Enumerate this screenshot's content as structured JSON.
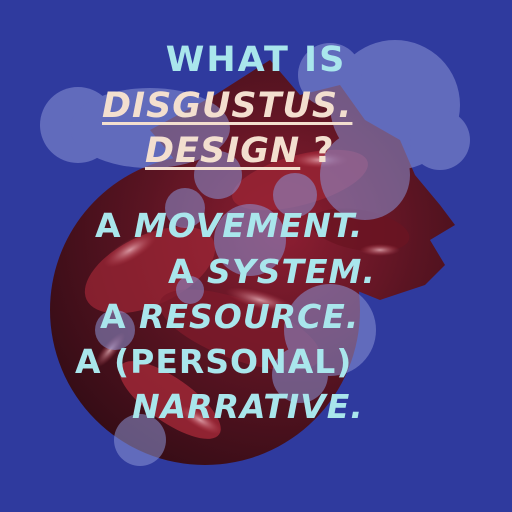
{
  "poster": {
    "question": {
      "line1": "WHAT IS",
      "line2": "DISGUSTUS.",
      "line3_word": "DESIGN",
      "line3_mark": "?"
    },
    "answers": [
      {
        "prefix": "A",
        "word": "MOVEMENT."
      },
      {
        "prefix": "A",
        "word": "SYSTEM."
      },
      {
        "prefix": "A",
        "word": "RESOURCE."
      },
      {
        "prefix": "A",
        "word": "(PERSONAL)"
      },
      {
        "prefix": "",
        "word": "NARRATIVE."
      }
    ]
  },
  "colors": {
    "background": "#2f3a9e",
    "text_cyan": "#a9e6ec",
    "text_cream": "#f3dfcf",
    "blob_light": "#8b93d6",
    "tissue_dark": "#3a0e18",
    "tissue_red": "#8e1e32"
  }
}
